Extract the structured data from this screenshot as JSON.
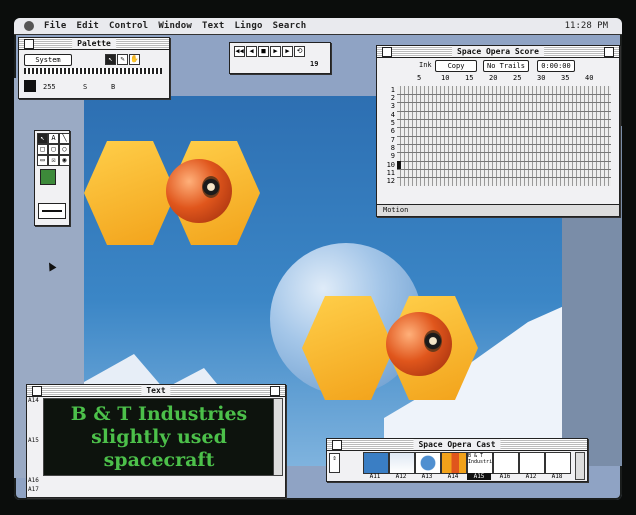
{
  "menubar": {
    "items": [
      "File",
      "Edit",
      "Control",
      "Window",
      "Text",
      "Lingo",
      "Search"
    ],
    "clock": "11:28 PM"
  },
  "palette": {
    "title": "Palette",
    "dropdown": "System",
    "value1": "255",
    "value2_label": "S",
    "value3_label": "B"
  },
  "control_panel": {
    "frame_counter": "19"
  },
  "score": {
    "title": "Space Opera Score",
    "ink_label": "Ink",
    "ink_value": "Copy",
    "trails": "No Trails",
    "time": "0:00:00",
    "column_numbers": [
      "5",
      "10",
      "15",
      "20",
      "25",
      "30",
      "35",
      "40"
    ],
    "row_numbers": [
      "1",
      "2",
      "3",
      "4",
      "5",
      "6",
      "7",
      "8",
      "9",
      "10",
      "11",
      "12"
    ],
    "footer": "Motion"
  },
  "text_window": {
    "title": "Text",
    "lines": [
      "B & T Industries",
      "slightly used",
      "spacecraft"
    ],
    "side_labels": [
      "A14",
      "A15",
      "A16",
      "A17"
    ]
  },
  "cast": {
    "title": "Space Opera Cast",
    "cells": [
      "A11",
      "A12",
      "A13",
      "A14",
      "A15",
      "A16",
      "A12",
      "A18"
    ],
    "text_cell": "B & T Industries"
  },
  "colors": {
    "stage_sky": "#3b86c6",
    "hex_yellow": "#f2a21a",
    "ball_orange": "#e0561c",
    "text_green": "#4cc04a"
  }
}
